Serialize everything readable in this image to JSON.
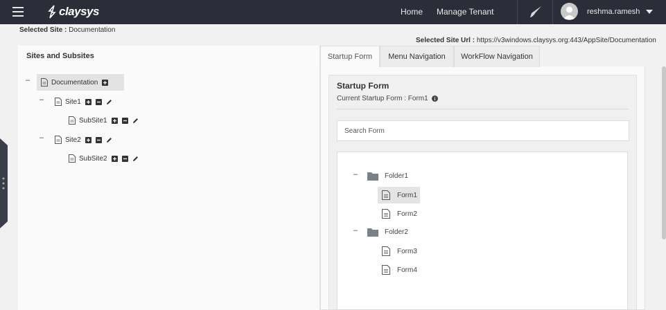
{
  "header": {
    "logo_text": "claysys",
    "nav": {
      "home": "Home",
      "manage_tenant": "Manage Tenant"
    },
    "username": "reshma.ramesh"
  },
  "selected_site": {
    "label": "Selected Site :",
    "value": "Documentation"
  },
  "selected_site_url": {
    "label": "Selected Site Url :",
    "value": "https://v3windows.claysys.org:443/AppSite/Documentation"
  },
  "sites_panel": {
    "title": "Sites and Subsites",
    "root": "Documentation",
    "site1": "Site1",
    "subsite1": "SubSite1",
    "site2": "Site2",
    "subsite2": "SubSite2"
  },
  "tabs": {
    "startup": "Startup Form",
    "menu": "Menu Navigation",
    "workflow": "WorkFlow Navigation"
  },
  "startup_form": {
    "title": "Startup Form",
    "current_label": "Current Startup Form : Form1",
    "search_placeholder": "Search Form",
    "folder1": "Folder1",
    "form1": "Form1",
    "form2": "Form2",
    "folder2": "Folder2",
    "form3": "Form3",
    "form4": "Form4"
  },
  "collapse_symbol": "–"
}
